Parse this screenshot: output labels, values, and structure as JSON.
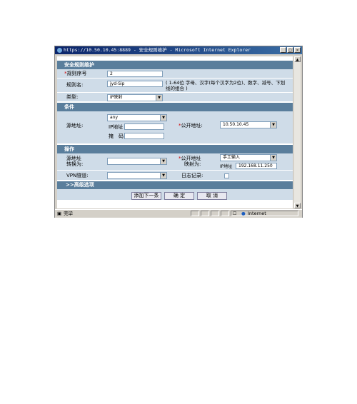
{
  "window": {
    "title": "https://10.50.10.45:8889 - 安全规则维护 - Microsoft Internet Explorer",
    "min_label": "_",
    "max_label": "□",
    "close_label": "×"
  },
  "form": {
    "section_title": "安全规则维护",
    "rule_no": {
      "label": "规则序号",
      "value": "2"
    },
    "rule_name": {
      "label": "规则名:",
      "value": "jyd-Sip",
      "hint": "( 1-64位 字母、汉字(每个汉字为2位)、数字、减号、下划线的组合 )"
    },
    "type": {
      "label": "类型:",
      "value": "IP映射"
    },
    "conditions": {
      "header": "条件",
      "source_label": "源地址:",
      "source_select": "any",
      "ip_label": "IP地址",
      "mask_label": "掩　码",
      "public_label": "公开地址:",
      "public_select": "10.50.10.45"
    },
    "operations": {
      "header": "操作",
      "src_convert_label_1": "源地址",
      "src_convert_label_2": "转换为:",
      "public_map_label_1": "公开地址",
      "public_map_label_2": "映射为:",
      "map_select": "手工输入",
      "ip_label": "IP地址",
      "ip_value": "192.168.11.250",
      "vpn_label": "VPN隧道:",
      "log_label": "日志记录:"
    },
    "advanced": ">>高级选项",
    "buttons": {
      "add_next": "添加下一条",
      "ok": "确 定",
      "cancel": "取 消"
    }
  },
  "statusbar": {
    "left": "完毕",
    "zone": "Internet"
  }
}
